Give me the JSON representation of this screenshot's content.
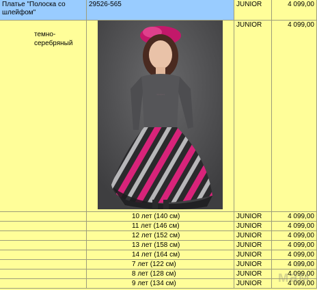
{
  "product": {
    "name": "Платье \"Полоска со шлейфом\"",
    "article": "29526-565",
    "category": "JUNIOR",
    "price": "4 099,00",
    "color": "темно-\nсеребряный"
  },
  "sizes": [
    {
      "size": "10 лет (140 см)",
      "category": "JUNIOR",
      "price": "4 099,00"
    },
    {
      "size": "11 лет (146 см)",
      "category": "JUNIOR",
      "price": "4 099,00"
    },
    {
      "size": "12 лет (152 см)",
      "category": "JUNIOR",
      "price": "4 099,00"
    },
    {
      "size": "13 лет (158 см)",
      "category": "JUNIOR",
      "price": "4 099,00"
    },
    {
      "size": "14 лет (164 см)",
      "category": "JUNIOR",
      "price": "4 099,00"
    },
    {
      "size": "7 лет (122 см)",
      "category": "JUNIOR",
      "price": "4 099,00"
    },
    {
      "size": "8 лет (128 см)",
      "category": "JUNIOR",
      "price": "4 099,00"
    },
    {
      "size": "9 лет (134 см)",
      "category": "JUNIOR",
      "price": "4 099,00"
    }
  ],
  "watermark": {
    "small": "для",
    "big": "мам"
  },
  "colors": {
    "sheet": "#fffe99",
    "selected": "#99ccff",
    "grid": "#9c9c7a"
  }
}
